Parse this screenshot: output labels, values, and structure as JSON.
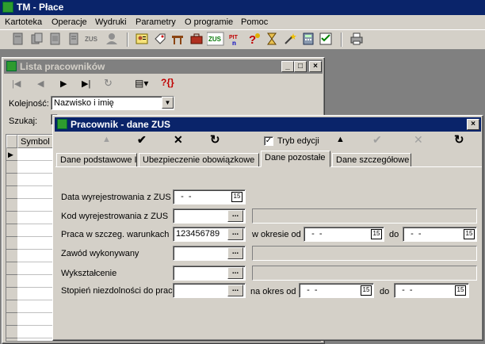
{
  "app": {
    "title": "TM - Płace",
    "menu": [
      "Kartoteka",
      "Operacje",
      "Wydruki",
      "Parametry",
      "O programie",
      "Pomoc"
    ]
  },
  "list_window": {
    "title": "Lista pracowników",
    "order_label": "Kolejność:",
    "order_value": "Nazwisko i imię",
    "search_label": "Szukaj:",
    "column_symbol": "Symbol"
  },
  "dialog": {
    "title": "Pracownik - dane ZUS",
    "edit_mode_label": "Tryb edycji",
    "edit_mode_checked": true,
    "tabs": [
      {
        "label": "Dane podstawowe I",
        "active": false
      },
      {
        "label": "Ubezpieczenie obowiązkowe",
        "active": false
      },
      {
        "label": "Dane pozostałe",
        "active": true
      },
      {
        "label": "Dane szczegółowe",
        "active": false
      }
    ],
    "fields": {
      "deregistration_date": {
        "label": "Data wyrejestrowania z ZUS",
        "value": "  -  -"
      },
      "deregistration_code": {
        "label": "Kod wyrejestrowania z ZUS",
        "value": ""
      },
      "special_conditions": {
        "label": "Praca w szczeg. warunkach",
        "value": "123456789",
        "period_from_label": "w okresie od",
        "from_value": "  -  -",
        "to_label": "do",
        "to_value": "  -  -"
      },
      "occupation": {
        "label": "Zawód wykonywany",
        "value": ""
      },
      "education": {
        "label": "Wykształcenie",
        "value": ""
      },
      "disability": {
        "label": "Stopień niezdolności do pracy",
        "value": "",
        "period_label": "na okres od",
        "from_value": "  -  -",
        "to_label": "do",
        "to_value": "  -  -"
      }
    }
  }
}
